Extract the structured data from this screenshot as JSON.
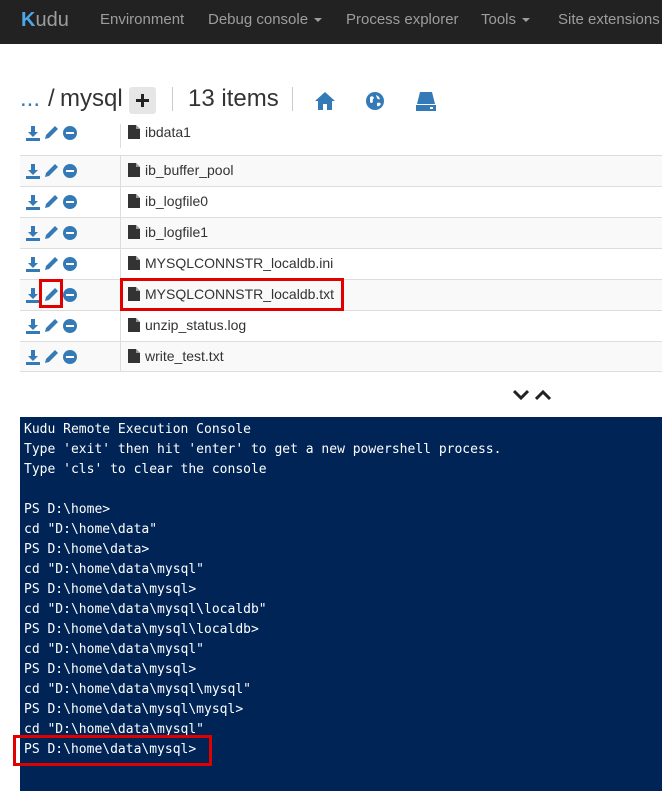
{
  "nav": {
    "brand_k": "K",
    "brand_rest": "udu",
    "items": [
      {
        "label": "Environment",
        "dropdown": false
      },
      {
        "label": "Debug console",
        "dropdown": true
      },
      {
        "label": "Process explorer",
        "dropdown": false
      },
      {
        "label": "Tools",
        "dropdown": true
      },
      {
        "label": "Site extensions",
        "dropdown": false
      }
    ]
  },
  "breadcrumb": {
    "ellipsis": "...",
    "separator": "/",
    "folder": "mysql",
    "items_count": "13 items"
  },
  "toolbar_icons": [
    "home-icon",
    "globe-icon",
    "drive-icon"
  ],
  "files": [
    {
      "name": "ibdata1"
    },
    {
      "name": "ib_buffer_pool"
    },
    {
      "name": "ib_logfile0"
    },
    {
      "name": "ib_logfile1"
    },
    {
      "name": "MYSQLCONNSTR_localdb.ini"
    },
    {
      "name": "MYSQLCONNSTR_localdb.txt"
    },
    {
      "name": "unzip_status.log"
    },
    {
      "name": "write_test.txt"
    }
  ],
  "console": {
    "lines": [
      "Kudu Remote Execution Console",
      "Type 'exit' then hit 'enter' to get a new powershell process.",
      "Type 'cls' to clear the console",
      "",
      "PS D:\\home>",
      "cd \"D:\\home\\data\"",
      "PS D:\\home\\data>",
      "cd \"D:\\home\\data\\mysql\"",
      "PS D:\\home\\data\\mysql>",
      "cd \"D:\\home\\data\\mysql\\localdb\"",
      "PS D:\\home\\data\\mysql\\localdb>",
      "cd \"D:\\home\\data\\mysql\"",
      "PS D:\\home\\data\\mysql>",
      "cd \"D:\\home\\data\\mysql\\mysql\"",
      "PS D:\\home\\data\\mysql\\mysql>",
      "cd \"D:\\home\\data\\mysql\"",
      "PS D:\\home\\data\\mysql>"
    ]
  },
  "colors": {
    "navbar": "#222222",
    "nav_text": "#9d9d9d",
    "accent_blue": "#337ab7",
    "console_bg": "#012456",
    "highlight_red": "#e00000"
  }
}
